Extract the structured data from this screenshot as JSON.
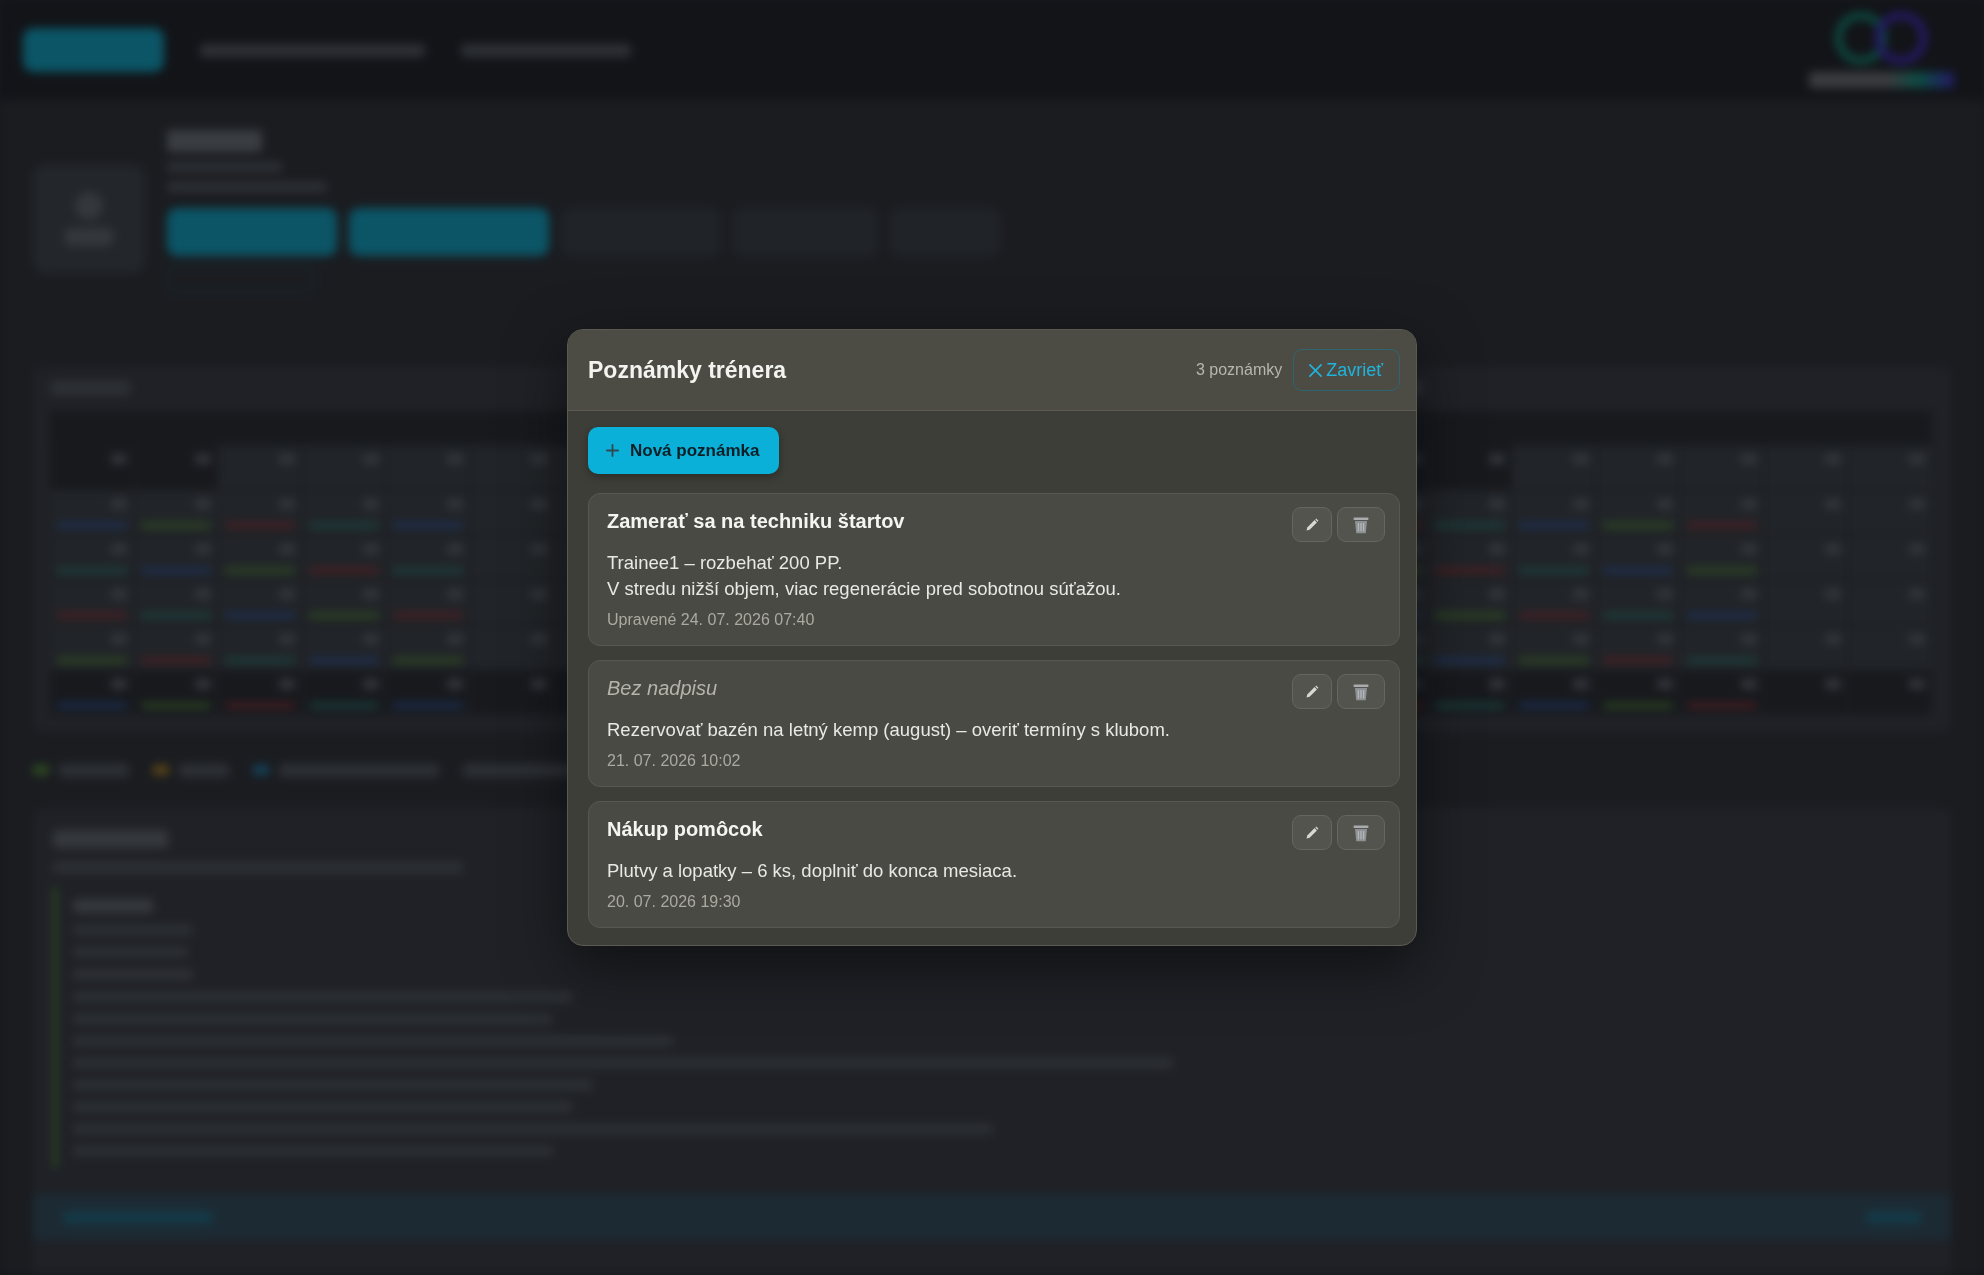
{
  "dialog": {
    "title": "Poznámky trénera",
    "note_count": "3 poznámky",
    "close_button": "Zavrieť",
    "new_note_button": "Nová poznámka"
  },
  "notes": [
    {
      "title": "Zamerať sa na techniku štartov",
      "untitled": false,
      "body": "Trainee1 – rozbehať 200 PP.\nV stredu nižší objem, viac regenerácie pred sobotnou súťažou.",
      "timestamp": "Upravené 24. 07. 2026 07:40"
    },
    {
      "title": "Bez nadpisu",
      "untitled": true,
      "body": "Rezervovať bazén na letný kemp (august) – overiť termíny s klubom.",
      "timestamp": "21. 07. 2026 10:02"
    },
    {
      "title": "Nákup pomôcok",
      "untitled": false,
      "body": "Plutvy a lopatky – 6 ks, doplniť do konca mesiaca.",
      "timestamp": "20. 07. 2026 19:30"
    }
  ]
}
